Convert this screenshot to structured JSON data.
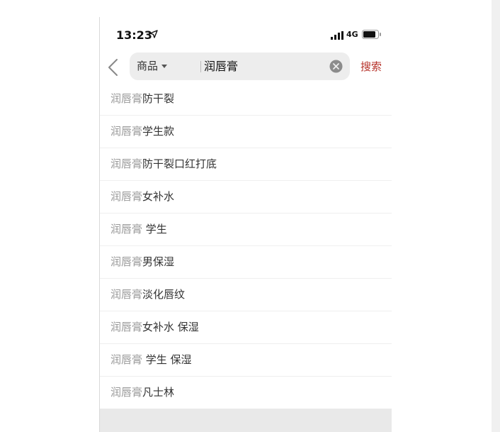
{
  "status_bar": {
    "time": "13:23",
    "network": "4G"
  },
  "search": {
    "scope_label": "商品",
    "query": "润唇膏",
    "submit_label": "搜索"
  },
  "suggestions": [
    {
      "keyword": "润唇膏",
      "suffix": "防干裂"
    },
    {
      "keyword": "润唇膏",
      "suffix": "学生款"
    },
    {
      "keyword": "润唇膏",
      "suffix": "防干裂口红打底"
    },
    {
      "keyword": "润唇膏",
      "suffix": "女补水"
    },
    {
      "keyword": "润唇膏",
      "suffix": " 学生"
    },
    {
      "keyword": "润唇膏",
      "suffix": "男保湿"
    },
    {
      "keyword": "润唇膏",
      "suffix": "淡化唇纹"
    },
    {
      "keyword": "润唇膏",
      "suffix": "女补水 保湿"
    },
    {
      "keyword": "润唇膏",
      "suffix": " 学生 保湿"
    },
    {
      "keyword": "润唇膏",
      "suffix": "凡士林"
    }
  ],
  "colors": {
    "accent": "#b6322a",
    "keyword_gray": "#999999",
    "text": "#333333"
  },
  "icons": [
    "location-arrow-icon",
    "signal-icon",
    "battery-icon",
    "back-arrow-icon",
    "caret-down-icon",
    "clear-icon"
  ]
}
